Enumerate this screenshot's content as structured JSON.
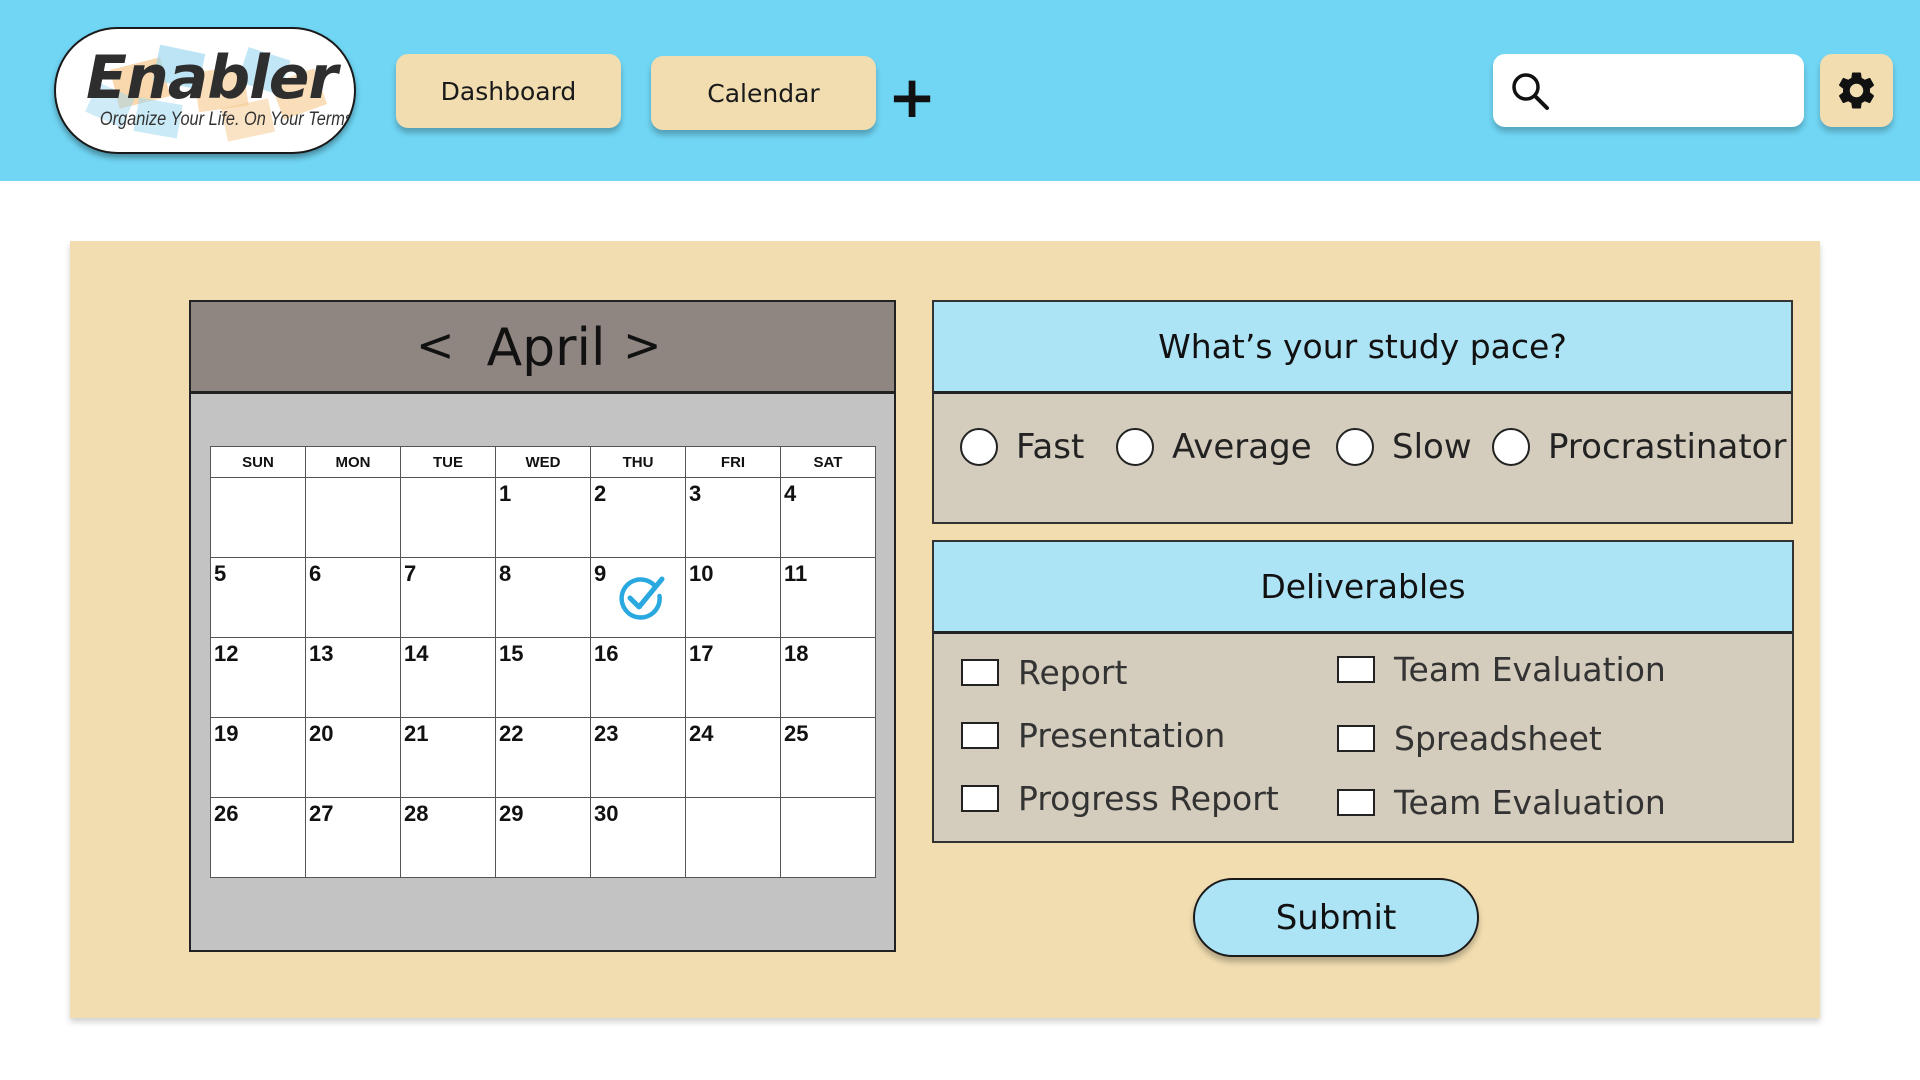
{
  "header": {
    "logo": {
      "wordmark": "Enabler",
      "tagline": "Organize Your Life. On Your Terms."
    },
    "nav": {
      "dashboard_label": "Dashboard",
      "calendar_label": "Calendar",
      "add_label": "+"
    },
    "search": {
      "icon": "search-icon",
      "value": ""
    },
    "settings": {
      "icon": "gear-icon"
    },
    "colors": {
      "bar": "#70d6f4",
      "button": "#f1ddb0"
    }
  },
  "calendar": {
    "prev_label": "<",
    "next_label": ">",
    "month": "April",
    "weekdays": [
      "SUN",
      "MON",
      "TUE",
      "WED",
      "THU",
      "FRI",
      "SAT"
    ],
    "weeks": [
      [
        "",
        "",
        "",
        "1",
        "2",
        "3",
        "4"
      ],
      [
        "5",
        "6",
        "7",
        "8",
        "9",
        "10",
        "11"
      ],
      [
        "12",
        "13",
        "14",
        "15",
        "16",
        "17",
        "18"
      ],
      [
        "19",
        "20",
        "21",
        "22",
        "23",
        "24",
        "25"
      ],
      [
        "26",
        "27",
        "28",
        "29",
        "30",
        "",
        ""
      ]
    ],
    "checked_day": "9",
    "check_icon": "checkmark-circle-icon",
    "check_color": "#2aa8e0"
  },
  "study_pace": {
    "question": "What’s your study pace?",
    "options": [
      "Fast",
      "Average",
      "Slow",
      "Procrastinator"
    ]
  },
  "deliverables": {
    "title": "Deliverables",
    "left_items": [
      "Report",
      "Presentation",
      "Progress Report"
    ],
    "right_items": [
      "Team Evaluation",
      "Spreadsheet",
      "Team Evaluation"
    ]
  },
  "submit_label": "Submit",
  "colors": {
    "panel": "#f1ddb0",
    "card_header": "#ace4f6",
    "card_body": "#d4cdbe",
    "calendar_header": "#8f8581"
  }
}
